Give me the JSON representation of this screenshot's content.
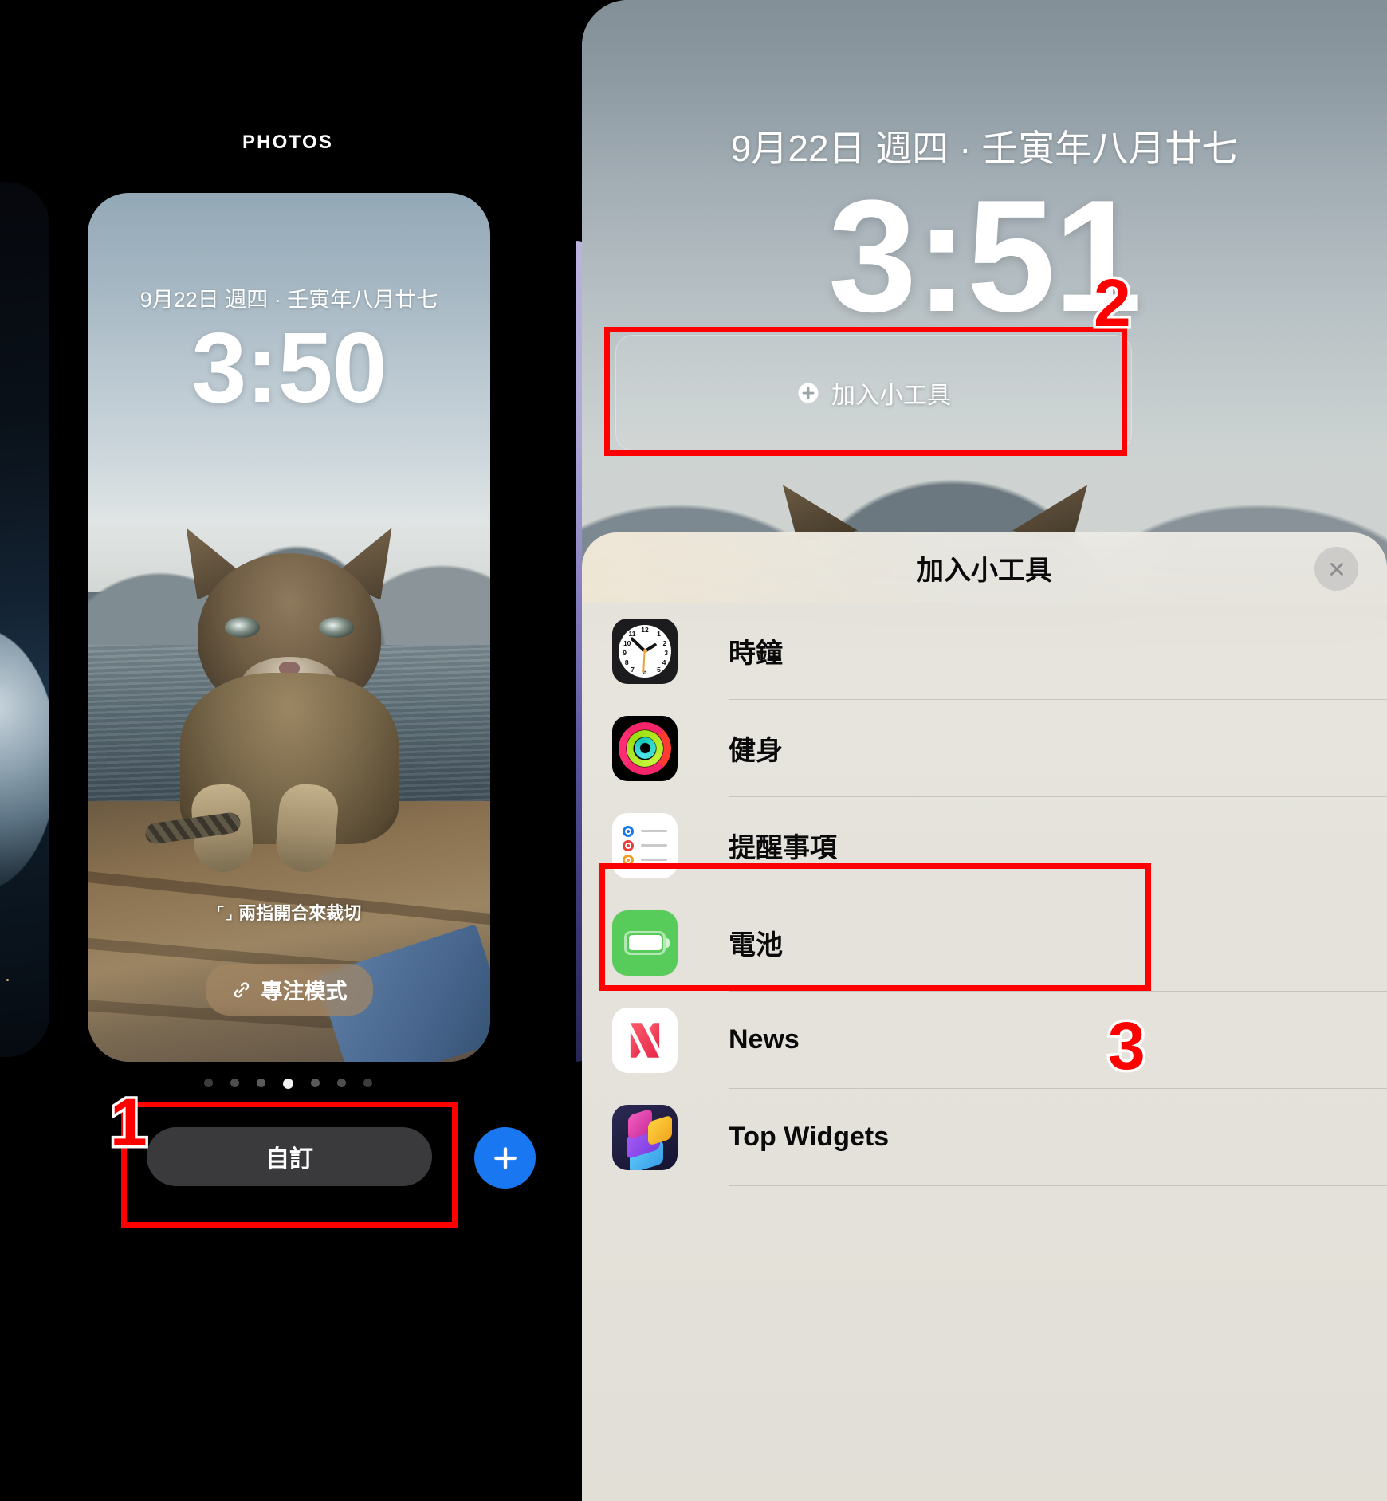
{
  "left": {
    "section_label": "PHOTOS",
    "lock_screen": {
      "date": "9月22日 週四 · 壬寅年八月廿七",
      "time": "3:50",
      "crop_hint": "兩指開合來裁切",
      "crop_hint_icon": "crop-icon",
      "focus_pill_label": "專注模式",
      "focus_pill_icon": "link-icon"
    },
    "page_dots": {
      "count": 7,
      "active_index": 3
    },
    "customize_button": "自訂",
    "add_button_icon": "plus-icon",
    "annotation": {
      "number": "1"
    }
  },
  "right": {
    "lock_screen": {
      "date": "9月22日 週四 · 壬寅年八月廿七",
      "time": "3:51",
      "widget_slot_label": "加入小工具",
      "widget_slot_icon": "plus-circle-icon"
    },
    "annotation_slot": {
      "number": "2"
    },
    "sheet": {
      "title": "加入小工具",
      "close_icon": "close-icon",
      "items": [
        {
          "label": "時鐘",
          "icon": "clock-icon"
        },
        {
          "label": "健身",
          "icon": "fitness-rings-icon"
        },
        {
          "label": "提醒事項",
          "icon": "reminders-icon"
        },
        {
          "label": "電池",
          "icon": "battery-icon"
        },
        {
          "label": "News",
          "icon": "news-icon"
        },
        {
          "label": "Top Widgets",
          "icon": "top-widgets-icon"
        }
      ]
    },
    "annotation_item": {
      "number": "3"
    }
  },
  "colors": {
    "annotation_red": "#ff0000",
    "accent_blue": "#1a77f2",
    "battery_green": "#58cc5b",
    "news_red": "#ef4056",
    "customize_bg": "#3a3a3c"
  }
}
